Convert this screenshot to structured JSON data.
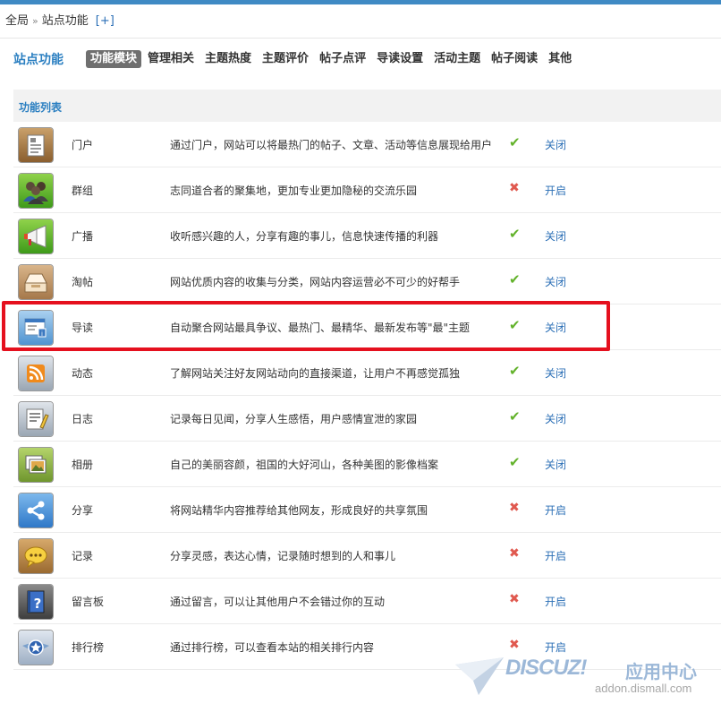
{
  "breadcrumb": {
    "root": "全局",
    "separator": "»",
    "current": "站点功能",
    "add": "[+]"
  },
  "page": {
    "section_title": "站点功能",
    "tabs": [
      {
        "label": "功能模块",
        "active": true
      },
      {
        "label": "管理相关",
        "active": false
      },
      {
        "label": "主题热度",
        "active": false
      },
      {
        "label": "主题评价",
        "active": false
      },
      {
        "label": "帖子点评",
        "active": false
      },
      {
        "label": "导读设置",
        "active": false
      },
      {
        "label": "活动主题",
        "active": false
      },
      {
        "label": "帖子阅读",
        "active": false
      },
      {
        "label": "其他",
        "active": false
      }
    ]
  },
  "list": {
    "header": "功能列表",
    "rows": [
      {
        "icon": "portal-newspaper-icon",
        "name": "门户",
        "desc": "通过门户，网站可以将最热门的帖子、文章、活动等信息展现给用户",
        "enabled": true,
        "status_glyph": "✔",
        "action": "关闭"
      },
      {
        "icon": "group-people-icon",
        "name": "群组",
        "desc": "志同道合者的聚集地，更加专业更加隐秘的交流乐园",
        "enabled": false,
        "status_glyph": "✖",
        "action": "开启"
      },
      {
        "icon": "broadcast-megaphone-icon",
        "name": "广播",
        "desc": "收听感兴趣的人，分享有趣的事儿，信息快速传播的利器",
        "enabled": true,
        "status_glyph": "✔",
        "action": "关闭"
      },
      {
        "icon": "collection-tray-icon",
        "name": "淘帖",
        "desc": "网站优质内容的收集与分类，网站内容运营必不可少的好帮手",
        "enabled": true,
        "status_glyph": "✔",
        "action": "关闭"
      },
      {
        "icon": "guide-window-icon",
        "name": "导读",
        "desc": "自动聚合网站最具争议、最热门、最精华、最新发布等\"最\"主题",
        "enabled": true,
        "status_glyph": "✔",
        "action": "关闭"
      },
      {
        "icon": "feed-rss-icon",
        "name": "动态",
        "desc": "了解网站关注好友网站动向的直接渠道，让用户不再感觉孤独",
        "enabled": true,
        "status_glyph": "✔",
        "action": "关闭"
      },
      {
        "icon": "blog-notepad-icon",
        "name": "日志",
        "desc": "记录每日见闻，分享人生感悟，用户感情宣泄的家园",
        "enabled": true,
        "status_glyph": "✔",
        "action": "关闭"
      },
      {
        "icon": "album-photo-icon",
        "name": "相册",
        "desc": "自己的美丽容颜，祖国的大好河山，各种美图的影像档案",
        "enabled": true,
        "status_glyph": "✔",
        "action": "关闭"
      },
      {
        "icon": "share-nodes-icon",
        "name": "分享",
        "desc": "将网站精华内容推荐给其他网友，形成良好的共享氛围",
        "enabled": false,
        "status_glyph": "✖",
        "action": "开启"
      },
      {
        "icon": "doing-chat-bubble-icon",
        "name": "记录",
        "desc": "分享灵感，表达心情，记录随时想到的人和事儿",
        "enabled": false,
        "status_glyph": "✖",
        "action": "开启"
      },
      {
        "icon": "guestbook-question-icon",
        "name": "留言板",
        "desc": "通过留言，可以让其他用户不会错过你的互动",
        "enabled": false,
        "status_glyph": "✖",
        "action": "开启"
      },
      {
        "icon": "ranking-star-badge-icon",
        "name": "排行榜",
        "desc": "通过排行榜，可以查看本站的相关排行内容",
        "enabled": false,
        "status_glyph": "✖",
        "action": "开启"
      }
    ]
  },
  "watermark": {
    "brand": "DISCUZ!",
    "brand_cn": "应用中心",
    "url": "addon.dismall.com"
  },
  "colors": {
    "accent": "#2b7fc1",
    "link": "#2b6fb6",
    "enabled": "#62b22a",
    "disabled": "#e0594f",
    "highlight": "#e5101e"
  }
}
